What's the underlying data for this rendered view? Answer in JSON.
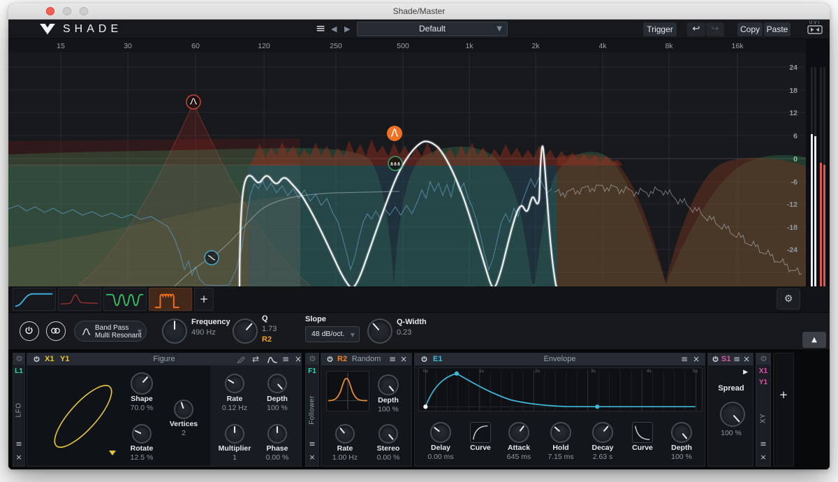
{
  "window": {
    "title": "Shade/Master"
  },
  "header": {
    "logo": "SHADE",
    "preset": {
      "value": "Default"
    },
    "trigger": "Trigger",
    "copy": "Copy",
    "paste": "Paste",
    "uvi": "UVI"
  },
  "display": {
    "freq_ticks": [
      "15",
      "30",
      "60",
      "120",
      "250",
      "500",
      "1k",
      "2k",
      "4k",
      "8k",
      "16k"
    ],
    "db_ticks": [
      "24",
      "18",
      "12",
      "6",
      "0",
      "-6",
      "-12",
      "-18",
      "-24"
    ]
  },
  "tabs": {
    "add": "+"
  },
  "filter": {
    "type": {
      "line1": "Band Pass",
      "line2": "Multi Resonant"
    },
    "frequency": {
      "label": "Frequency",
      "value": "490 Hz"
    },
    "q": {
      "label": "Q",
      "value": "1.73",
      "mod": "R2"
    },
    "slope": {
      "label": "Slope",
      "value": "48 dB/oct."
    },
    "qwidth": {
      "label": "Q-Width",
      "value": "0.23"
    }
  },
  "mods": {
    "lfo_strip": {
      "id": "L1",
      "type": "LFO"
    },
    "figure": {
      "x": "X1",
      "y": "Y1",
      "title": "Figure",
      "shape": {
        "label": "Shape",
        "value": "70.0 %"
      },
      "vertices": {
        "label": "Vertices",
        "value": "2"
      },
      "rotate": {
        "label": "Rotate",
        "value": "12.5 %"
      },
      "rate": {
        "label": "Rate",
        "value": "0.12 Hz"
      },
      "depth": {
        "label": "Depth",
        "value": "100 %"
      },
      "multiplier": {
        "label": "Multiplier",
        "value": "1"
      },
      "phase": {
        "label": "Phase",
        "value": "0.00 %"
      }
    },
    "follower_strip": {
      "id": "F1",
      "type": "Follower"
    },
    "random": {
      "id": "R2",
      "title": "Random",
      "depth": {
        "label": "Depth",
        "value": "100 %"
      },
      "rate": {
        "label": "Rate",
        "value": "1.00 Hz"
      },
      "stereo": {
        "label": "Stereo",
        "value": "0.00 %"
      }
    },
    "envelope": {
      "id": "E1",
      "title": "Envelope",
      "time_ticks": [
        "0s",
        "1s",
        "2s",
        "3s",
        "4s",
        "5s"
      ],
      "delay": {
        "label": "Delay",
        "value": "0.00 ms"
      },
      "curve1": {
        "label": "Curve"
      },
      "attack": {
        "label": "Attack",
        "value": "645 ms"
      },
      "hold": {
        "label": "Hold",
        "value": "7.15 ms"
      },
      "decay": {
        "label": "Decay",
        "value": "2.63 s"
      },
      "curve2": {
        "label": "Curve"
      },
      "depth": {
        "label": "Depth",
        "value": "100 %"
      }
    },
    "spread_panel": {
      "id": "S1",
      "spread": {
        "label": "Spread",
        "value": "100 %"
      }
    },
    "xy_strip": {
      "x": "X1",
      "y": "Y1",
      "type": "XY"
    },
    "add": "+"
  },
  "colors": {
    "accent_cyan": "#41b9d9",
    "accent_teal": "#2fd6b0",
    "accent_yellow": "#e7c83b",
    "accent_orange": "#f08222",
    "accent_magenta": "#e055a5",
    "meter_red": "#e2574e",
    "curve_white": "#eef2f5",
    "fill_green": "#3e8e5c",
    "fill_red": "#a5301e",
    "fill_teal": "#2a5a6e"
  }
}
